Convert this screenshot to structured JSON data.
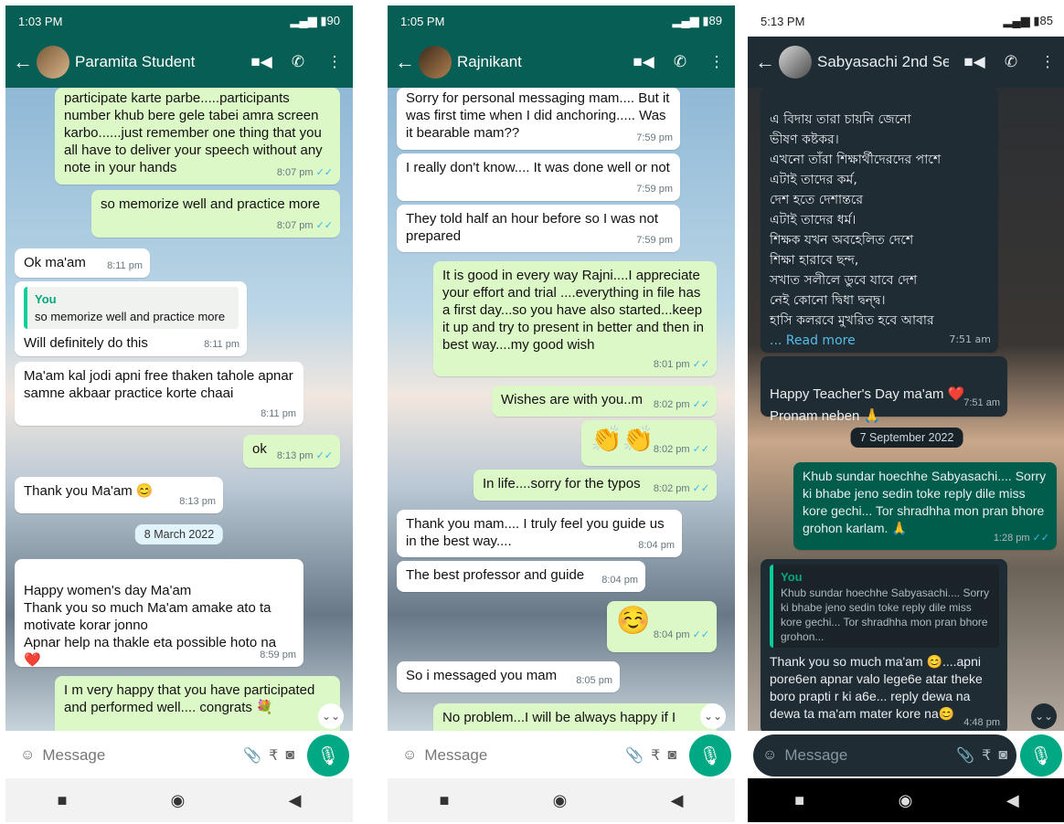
{
  "phones": [
    {
      "status": {
        "time": "1:03 PM",
        "battery": "90"
      },
      "contact": "Paramita Student",
      "messages": [
        {
          "text": "participate karte parbe.....participants number khub bere gele tabei amra screen karbo......just remember one thing that you all have to deliver your speech without any note in your hands",
          "time": "8:07 pm"
        },
        {
          "text": "so memorize well and practice more",
          "time": "8:07 pm"
        },
        {
          "text": "Ok ma'am",
          "time": "8:11 pm"
        },
        {
          "quote_name": "You",
          "quote_text": "so memorize well and practice more",
          "text": "Will definitely do this",
          "time": "8:11 pm"
        },
        {
          "text": "Ma'am kal jodi apni free thaken tahole apnar samne akbaar practice korte chaai",
          "time": "8:11 pm"
        },
        {
          "text": "ok",
          "time": "8:13 pm"
        },
        {
          "text": "Thank you Ma'am 😊",
          "time": "8:13 pm"
        },
        {
          "text": "Happy women's day Ma'am\nThank you so much Ma'am amake ato ta motivate korar jonno\nApnar help na thakle eta possible hoto na\n❤️",
          "time": "8:59 pm"
        },
        {
          "text": "I m very happy that you have participated and performed well.... congrats 💐",
          "time": ""
        }
      ],
      "date": "8 March 2022",
      "input_placeholder": "Message"
    },
    {
      "status": {
        "time": "1:05 PM",
        "battery": "89"
      },
      "contact": "Rajnikant",
      "messages": [
        {
          "text": "Sorry for personal messaging mam.... But it was first time when I did anchoring..... Was it bearable mam??",
          "time": "7:59 pm"
        },
        {
          "text": "I really don't know.... It was done well or not",
          "time": "7:59 pm"
        },
        {
          "text": "They told half an hour before so I was not prepared",
          "time": "7:59 pm"
        },
        {
          "text": "It is good in every way Rajni....I appreciate your effort and trial ....everything in file has a first day...so you have also started...keep it up and try to present in better and then in best way....my good wish",
          "time": "8:01 pm"
        },
        {
          "text": "Wishes are with you..m",
          "time": "8:02 pm"
        },
        {
          "text": "👏👏",
          "time": "8:02 pm"
        },
        {
          "text": "In life....sorry for the typos",
          "time": "8:02 pm"
        },
        {
          "text": "Thank you mam.... I truly feel you guide us in the best way....",
          "time": "8:04 pm"
        },
        {
          "text": "The best professor and guide",
          "time": "8:04 pm"
        },
        {
          "text": "☺️",
          "time": "8:04 pm"
        },
        {
          "text": "So i messaged you mam",
          "time": "8:05 pm"
        },
        {
          "text": "No problem...I will be always happy if I",
          "time": ""
        }
      ],
      "input_placeholder": "Message"
    },
    {
      "status": {
        "time": "5:13 PM",
        "battery": "85"
      },
      "contact": "Sabyasachi 2nd Sem",
      "messages": [
        {
          "text": "এ বিদায় তারা চায়নি জেনো\n   ভীষণ কষ্টকর।\nএখনো তাঁরা শিক্ষার্থীদেরদের পাশে\n   এটাই তাদের কর্ম,\nদেশ হতে দেশান্তরে\n   এটাই তাদের ধর্ম।\nশিক্ষক যখন অবহেলিত দেশে\n   শিক্ষা হারাবে ছন্দ,\nসখাত সলীলে ডুবে যাবে দেশ\n   নেই কোনো দ্বিধা দ্বন্দ্ব।\nহাসি কলরবে মুখরিত হবে আবার",
          "read_more": "... Read more",
          "time": "7:51 am"
        },
        {
          "text": "Happy Teacher's Day ma'am ❤️\nPronam neben 🙏",
          "time": "7:51 am"
        },
        {
          "text": "Khub sundar hoechhe Sabyasachi.... Sorry ki bhabe jeno sedin toke reply dile miss kore gechi... Tor shradhha mon pran bhore grohon karlam. 🙏",
          "time": "1:28 pm"
        },
        {
          "quote_name": "You",
          "quote_text": "Khub sundar hoechhe Sabyasachi.... Sorry ki bhabe jeno sedin toke reply dile miss kore gechi... Tor shradhha mon pran bhore grohon...",
          "text": "Thank you so much ma'am 😊....apni pore6en apnar valo lege6e atar theke boro prapti r ki a6e... reply dewa na dewa ta ma'am mater kore na😊",
          "time": "4:48 pm"
        }
      ],
      "date": "7 September 2022",
      "input_placeholder": "Message"
    }
  ],
  "colors": {
    "header": "#075e54",
    "header_dark": "#1f2c34",
    "incoming": "#ffffff",
    "outgoing": "#dcf8c6",
    "accent": "#00a884"
  }
}
